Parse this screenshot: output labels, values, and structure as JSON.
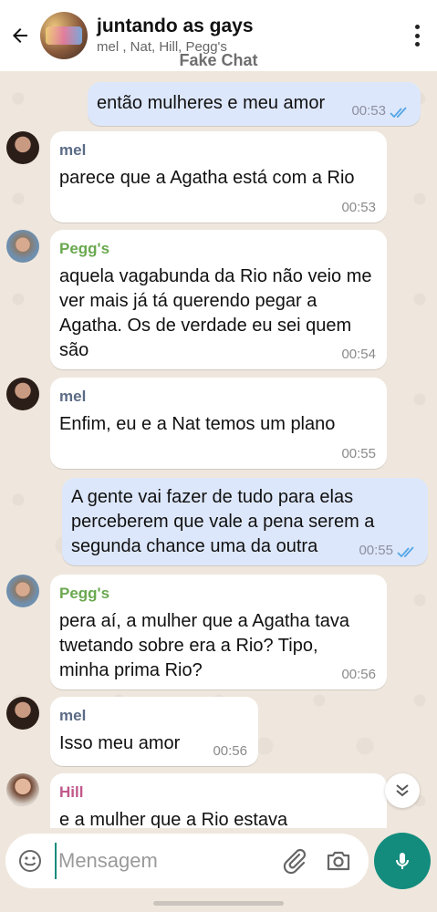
{
  "header": {
    "title": "juntando as gays",
    "members": "mel , Nat, Hill, Pegg's",
    "watermark": "Fake Chat"
  },
  "colors": {
    "outgoing_bubble": "#dde7fb",
    "incoming_bubble": "#ffffff",
    "accent": "#138c7e",
    "read_ticks": "#53a6e6",
    "name_mel": "#5b6b86",
    "name_pegg": "#6aa84f",
    "name_hill": "#c0588a"
  },
  "messages": [
    {
      "type": "outgoing",
      "text": "então mulheres e meu amor",
      "time": "00:53",
      "status": "read"
    },
    {
      "type": "incoming",
      "sender": "mel",
      "text": "parece que a Agatha está com a Rio",
      "time": "00:53"
    },
    {
      "type": "incoming",
      "sender": "Pegg's",
      "text": "aquela vagabunda da Rio não veio me ver mais já tá querendo pegar a Agatha. Os de verdade eu sei quem são",
      "time": "00:54"
    },
    {
      "type": "incoming",
      "sender": "mel",
      "text": "Enfim, eu e a Nat temos um plano",
      "time": "00:55"
    },
    {
      "type": "outgoing",
      "text": "A gente vai fazer de tudo para elas perceberem que vale a pena serem a segunda chance uma da outra",
      "time": "00:55",
      "status": "read"
    },
    {
      "type": "incoming",
      "sender": "Pegg's",
      "text": "pera aí, a mulher que a Agatha tava twetando sobre era a Rio? Tipo, minha prima Rio?",
      "time": "00:56"
    },
    {
      "type": "incoming",
      "sender": "mel",
      "text": "Isso meu amor",
      "time": "00:56"
    },
    {
      "type": "incoming",
      "sender": "Hill",
      "text": "e a mulher que a Rio estava",
      "time": ""
    }
  ],
  "composer": {
    "placeholder": "Mensagem"
  },
  "icons": {
    "back": "arrow-left-icon",
    "menu": "more-vertical-icon",
    "emoji": "emoji-icon",
    "attach": "paperclip-icon",
    "camera": "camera-icon",
    "mic": "microphone-icon",
    "scroll": "chevron-double-down-icon"
  }
}
